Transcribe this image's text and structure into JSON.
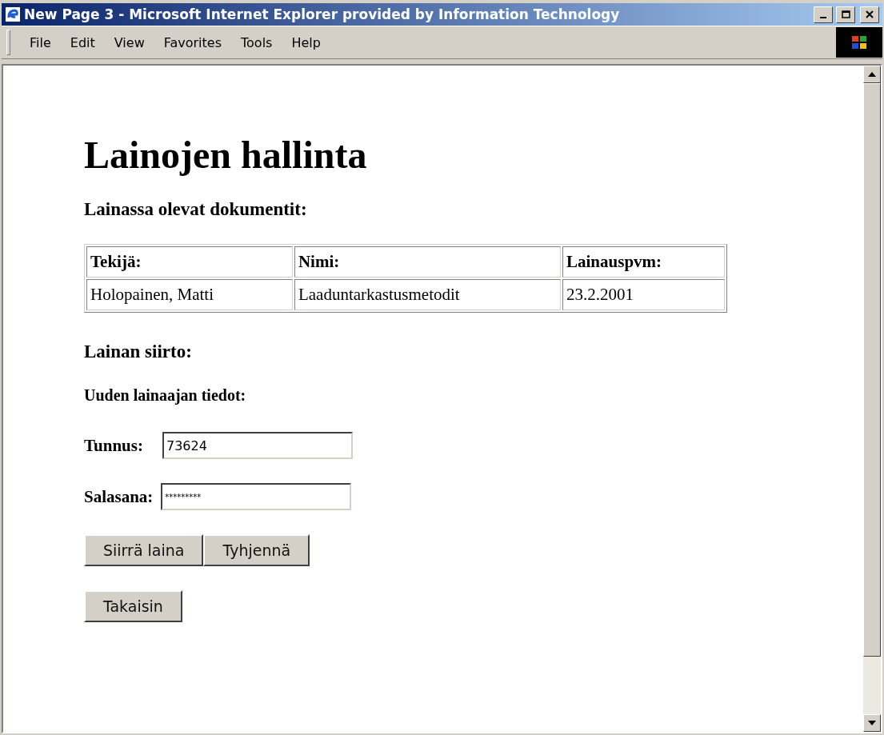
{
  "window": {
    "title": "New Page 3 - Microsoft Internet Explorer provided by Information Technology"
  },
  "menu": [
    "File",
    "Edit",
    "View",
    "Favorites",
    "Tools",
    "Help"
  ],
  "page": {
    "title": "Lainojen hallinta",
    "loans_heading": "Lainassa olevat dokumentit:",
    "table": {
      "columns": [
        "Tekijä:",
        "Nimi:",
        "Lainauspvm:"
      ],
      "rows": [
        [
          "Holopainen, Matti",
          "Laaduntarkastusmetodit",
          "23.2.2001"
        ]
      ]
    },
    "transfer_heading": "Lainan siirto:",
    "new_borrower_heading": "Uuden lainaajan tiedot:",
    "fields": [
      {
        "label": "Tunnus:",
        "value": "73624",
        "kind": "text"
      },
      {
        "label": "Salasana:",
        "value": "*********",
        "kind": "password"
      }
    ],
    "buttons": [
      "Siirrä laina",
      "Tyhjennä"
    ],
    "back_button": "Takaisin"
  }
}
